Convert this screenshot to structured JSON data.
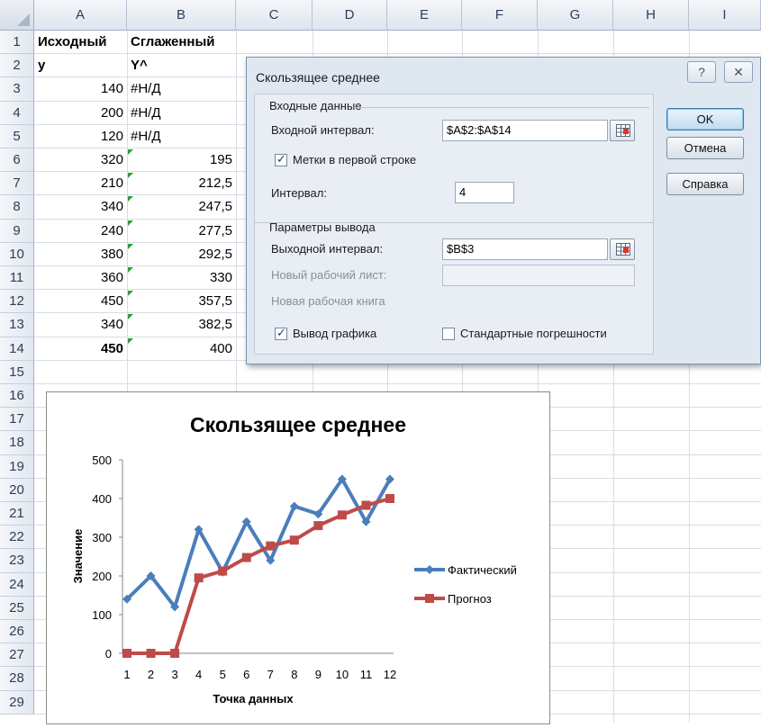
{
  "columns": [
    "A",
    "B",
    "C",
    "D",
    "E",
    "F",
    "G",
    "H",
    "I"
  ],
  "rows": [
    "1",
    "2",
    "3",
    "4",
    "5",
    "6",
    "7",
    "8",
    "9",
    "10",
    "11",
    "12",
    "13",
    "14",
    "15",
    "16",
    "17",
    "18",
    "19",
    "20",
    "21",
    "22",
    "23",
    "24",
    "25",
    "26",
    "27",
    "28",
    "29"
  ],
  "sheet": {
    "header_row1": [
      "Исходный",
      "Сглаженный"
    ],
    "header_row2": [
      "y",
      "Y^"
    ],
    "col_a": [
      "140",
      "200",
      "120",
      "320",
      "210",
      "340",
      "240",
      "380",
      "360",
      "450",
      "340",
      "450"
    ],
    "col_b": [
      "#Н/Д",
      "#Н/Д",
      "#Н/Д",
      "195",
      "212,5",
      "247,5",
      "277,5",
      "292,5",
      "330",
      "357,5",
      "382,5",
      "400"
    ]
  },
  "dialog": {
    "title": "Скользящее среднее",
    "help_icon": "question-icon",
    "close_icon": "close-icon",
    "input_group": "Входные данные",
    "input_range_label": "Входной интервал:",
    "input_range_value": "$A$2:$A$14",
    "labels_first_row": "Метки в первой строке",
    "labels_first_row_checked": true,
    "interval_label": "Интервал:",
    "interval_value": "4",
    "output_group": "Параметры вывода",
    "output_range_label": "Выходной интервал:",
    "output_range_value": "$B$3",
    "new_sheet_label": "Новый рабочий лист:",
    "new_workbook_label": "Новая рабочая книга",
    "chart_output": "Вывод графика",
    "chart_output_checked": true,
    "std_errors": "Стандартные погрешности",
    "std_errors_checked": false,
    "ok": "OK",
    "cancel": "Отмена",
    "help": "Справка"
  },
  "chart_data": {
    "type": "line",
    "title": "Скользящее среднее",
    "xlabel": "Точка данных",
    "ylabel": "Значение",
    "categories": [
      "1",
      "2",
      "3",
      "4",
      "5",
      "6",
      "7",
      "8",
      "9",
      "10",
      "11",
      "12"
    ],
    "ylim": [
      0,
      500
    ],
    "yticks": [
      "0",
      "100",
      "200",
      "300",
      "400",
      "500"
    ],
    "series": [
      {
        "name": "Фактический",
        "color": "#4a7ebb",
        "marker": "diamond",
        "values": [
          140,
          200,
          120,
          320,
          210,
          340,
          240,
          380,
          360,
          450,
          340,
          450
        ]
      },
      {
        "name": "Прогноз",
        "color": "#be4b48",
        "marker": "square",
        "values": [
          0,
          0,
          0,
          195,
          212.5,
          247.5,
          277.5,
          292.5,
          330,
          357.5,
          382.5,
          400
        ]
      }
    ],
    "legend": "right"
  }
}
